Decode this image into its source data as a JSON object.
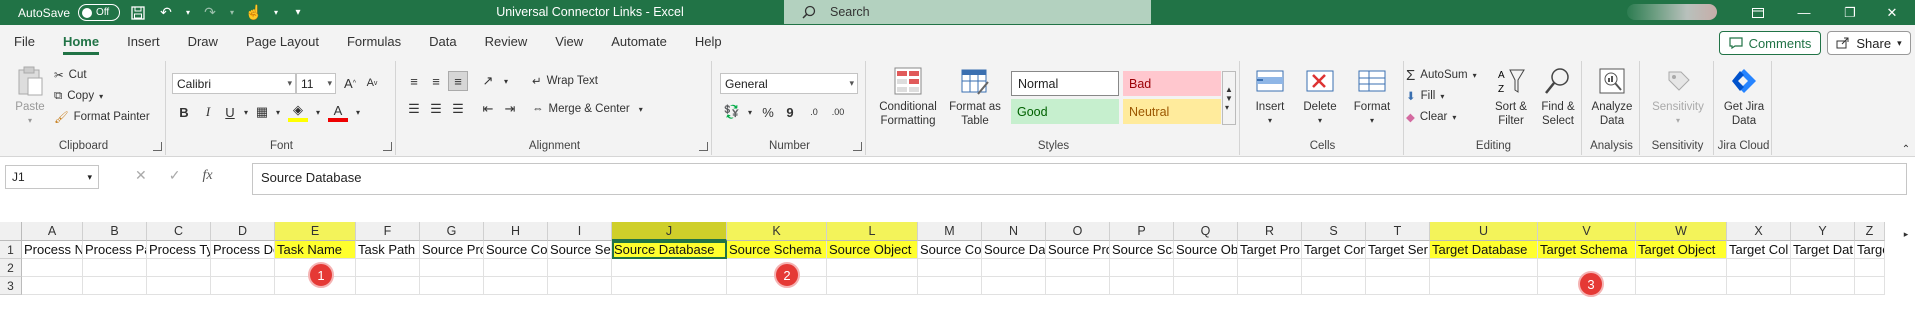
{
  "titlebar": {
    "autosave_label": "AutoSave",
    "autosave_state": "Off",
    "doc_title": "Universal Connector Links  -  Excel",
    "search_placeholder": "Search",
    "icons": [
      "save-icon",
      "undo-icon",
      "redo-icon",
      "touch-mode-icon",
      "customize-icon"
    ]
  },
  "tabs": [
    "File",
    "Home",
    "Insert",
    "Draw",
    "Page Layout",
    "Formulas",
    "Data",
    "Review",
    "View",
    "Automate",
    "Help"
  ],
  "active_tab": "Home",
  "comments_label": "Comments",
  "share_label": "Share",
  "ribbon": {
    "clipboard": {
      "paste": "Paste",
      "cut": "Cut",
      "copy": "Copy",
      "format_painter": "Format Painter",
      "label": "Clipboard"
    },
    "font": {
      "name": "Calibri",
      "size": "11",
      "label": "Font"
    },
    "alignment": {
      "wrap": "Wrap Text",
      "merge": "Merge & Center",
      "label": "Alignment"
    },
    "number": {
      "format": "General",
      "label": "Number"
    },
    "styles": {
      "conditional": "Conditional Formatting",
      "format_table": "Format as Table",
      "normal": "Normal",
      "bad": "Bad",
      "good": "Good",
      "neutral": "Neutral",
      "label": "Styles"
    },
    "cells": {
      "insert": "Insert",
      "delete": "Delete",
      "format": "Format",
      "label": "Cells"
    },
    "editing": {
      "autosum": "AutoSum",
      "fill": "Fill",
      "clear": "Clear",
      "sort": "Sort & Filter",
      "find": "Find & Select",
      "label": "Editing"
    },
    "analysis": {
      "analyze": "Analyze Data",
      "label": "Analysis"
    },
    "sensitivity": {
      "sensitivity": "Sensitivity",
      "label": "Sensitivity"
    },
    "jira": {
      "get": "Get Jira Data",
      "label": "Jira Cloud"
    }
  },
  "formula_bar": {
    "name_box": "J1",
    "content": "Source Database",
    "fx": "fx"
  },
  "columns": [
    "A",
    "B",
    "C",
    "D",
    "E",
    "F",
    "G",
    "H",
    "I",
    "J",
    "K",
    "L",
    "M",
    "N",
    "O",
    "P",
    "Q",
    "R",
    "S",
    "T",
    "U",
    "V",
    "W",
    "X",
    "Y",
    "Z"
  ],
  "rows": [
    "1",
    "2",
    "3"
  ],
  "row1": [
    "Process N",
    "Process Pa",
    "Process Ty",
    "Process De",
    "Task Name",
    "Task Path",
    "Source Pro",
    "Source Co",
    "Source Se",
    "Source Database",
    "Source Schema",
    "Source Object",
    "Source Co",
    "Source Da",
    "Source Pro",
    "Source Sca",
    "Source Ob",
    "Target Pro",
    "Target Con",
    "Target Ser",
    "Target Database",
    "Target Schema",
    "Target Object",
    "Target Col",
    "Target Dat",
    "Targe"
  ],
  "highlighted_columns": [
    "E",
    "J",
    "K",
    "L",
    "U",
    "V",
    "W"
  ],
  "active_cell": "J1",
  "badges": [
    "1",
    "2",
    "3"
  ],
  "colors": {
    "excel_green": "#217346",
    "highlight": "#ffff2e",
    "badge_red": "#e53935"
  }
}
